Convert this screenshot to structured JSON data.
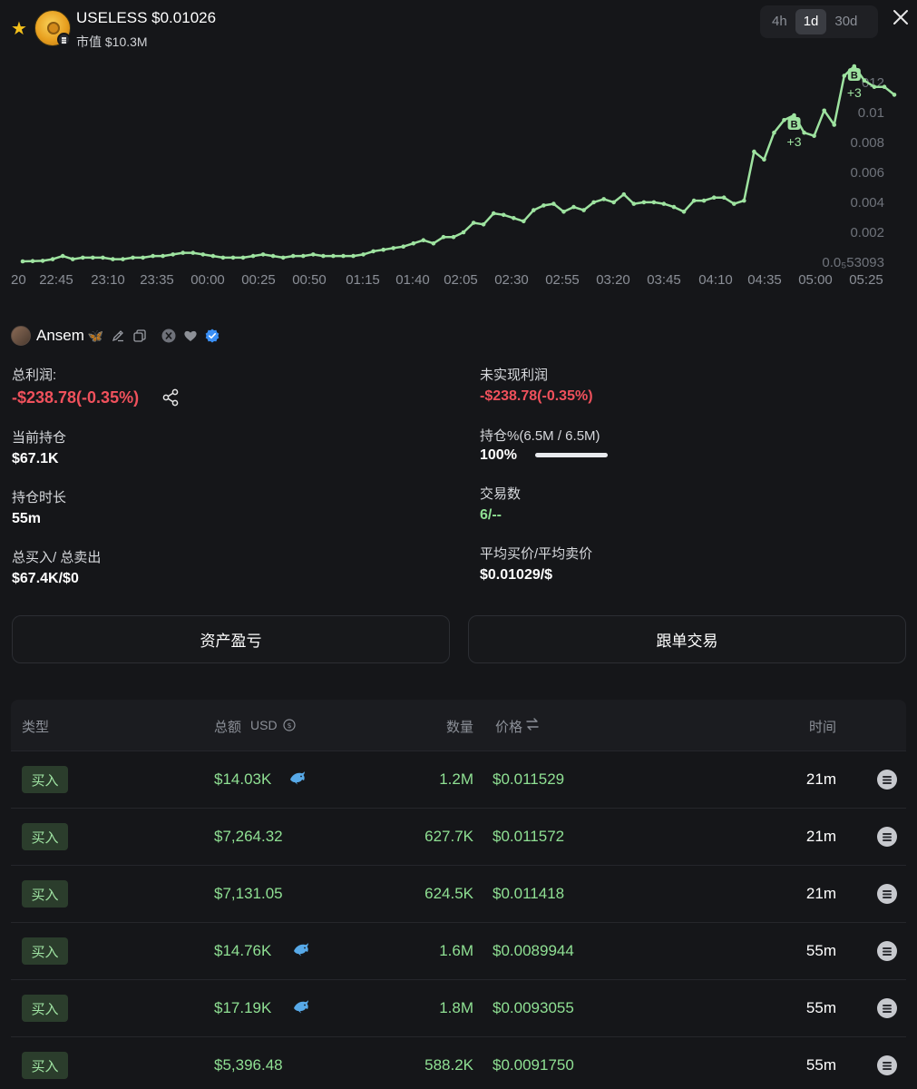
{
  "header": {
    "token_title": "USELESS $0.01026",
    "mcap_label": "市值",
    "mcap_value": "$10.3M",
    "timeframes": [
      "4h",
      "1d",
      "30d"
    ],
    "active_timeframe": "1d"
  },
  "colors": {
    "background": "#151619",
    "accent_green": "#8fe093",
    "loss_red": "#f0515c",
    "star_yellow": "#f5c11b",
    "line_green": "#9ee3a0"
  },
  "chart_data": {
    "type": "line",
    "x_ticks": [
      "20",
      "22:45",
      "23:10",
      "23:35",
      "00:00",
      "00:25",
      "00:50",
      "01:15",
      "01:40",
      "02:05",
      "02:30",
      "02:55",
      "03:20",
      "03:45",
      "04:10",
      "04:35",
      "05:00",
      "05:25"
    ],
    "y_ticks": [
      "0.0₅53093",
      "0.002",
      "0.004",
      "0.006",
      "0.008",
      "0.01",
      "012"
    ],
    "ylim": [
      5.3093e-06,
      0.012
    ],
    "grid": false,
    "series": [
      {
        "values": [
          6e-05,
          8e-05,
          0.0001,
          0.0002,
          0.0004,
          0.0002,
          0.0003,
          0.0003,
          0.0003,
          0.0002,
          0.0002,
          0.0003,
          0.0003,
          0.0004,
          0.0004,
          0.0005,
          0.0006,
          0.0006,
          0.0005,
          0.0004,
          0.0003,
          0.0003,
          0.0003,
          0.0004,
          0.0005,
          0.0004,
          0.0003,
          0.0004,
          0.0004,
          0.0005,
          0.0004,
          0.0004,
          0.0004,
          0.0004,
          0.0005,
          0.0007,
          0.0008,
          0.0009,
          0.001,
          0.0012,
          0.0014,
          0.0012,
          0.0016,
          0.0016,
          0.0019,
          0.0025,
          0.0024,
          0.0031,
          0.003,
          0.0028,
          0.0026,
          0.0033,
          0.0036,
          0.0037,
          0.0032,
          0.0035,
          0.0033,
          0.0038,
          0.004,
          0.0038,
          0.0043,
          0.0037,
          0.0038,
          0.0038,
          0.0037,
          0.0035,
          0.0032,
          0.0039,
          0.0039,
          0.0041,
          0.0041,
          0.0037,
          0.0039,
          0.007,
          0.0065,
          0.0082,
          0.009,
          0.0093,
          0.0082,
          0.008,
          0.0096,
          0.0087,
          0.0118,
          0.0124,
          0.0115,
          0.0111,
          0.0111,
          0.0106
        ]
      }
    ],
    "trade_markers": [
      {
        "label": "B",
        "count_label": "+3",
        "index": 77
      },
      {
        "label": "B",
        "count_label": "+3",
        "index": 83
      }
    ]
  },
  "trader": {
    "name": "Ansem",
    "icons": [
      "butterfly-icon",
      "edit-icon",
      "copy-icon",
      "x-icon",
      "heart-icon",
      "verified-icon"
    ]
  },
  "stats": {
    "total_pnl_label": "总利润:",
    "total_pnl_value": "-$238.78(-0.35%)",
    "unrealized_label": "未实现利润",
    "unrealized_value": "-$238.78(-0.35%)",
    "position_label": "当前持仓",
    "position_value": "$67.1K",
    "holding_pct_label": "持仓%(6.5M / 6.5M)",
    "holding_pct_value": "100%",
    "holding_fraction": 1.0,
    "duration_label": "持仓时长",
    "duration_value": "55m",
    "trades_label": "交易数",
    "trades_value": "6/--",
    "buy_sell_label": "总买入/ 总卖出",
    "buy_sell_value": "$67.4K/$0",
    "avg_price_label": "平均买价/平均卖价",
    "avg_price_value": "$0.01029/$"
  },
  "actions": {
    "pnl_button": "资产盈亏",
    "copy_trade_button": "跟单交易"
  },
  "table": {
    "headers": {
      "type": "类型",
      "total": "总额",
      "unit": "USD",
      "quantity": "数量",
      "price": "价格",
      "time": "时间"
    },
    "rows": [
      {
        "type": "买入",
        "total": "$14.03K",
        "whale": true,
        "quantity": "1.2M",
        "price": "$0.011529",
        "time": "21m"
      },
      {
        "type": "买入",
        "total": "$7,264.32",
        "whale": false,
        "quantity": "627.7K",
        "price": "$0.011572",
        "time": "21m"
      },
      {
        "type": "买入",
        "total": "$7,131.05",
        "whale": false,
        "quantity": "624.5K",
        "price": "$0.011418",
        "time": "21m"
      },
      {
        "type": "买入",
        "total": "$14.76K",
        "whale": true,
        "quantity": "1.6M",
        "price": "$0.0089944",
        "time": "55m"
      },
      {
        "type": "买入",
        "total": "$17.19K",
        "whale": true,
        "quantity": "1.8M",
        "price": "$0.0093055",
        "time": "55m"
      },
      {
        "type": "买入",
        "total": "$5,396.48",
        "whale": false,
        "quantity": "588.2K",
        "price": "$0.0091750",
        "time": "55m"
      }
    ]
  }
}
